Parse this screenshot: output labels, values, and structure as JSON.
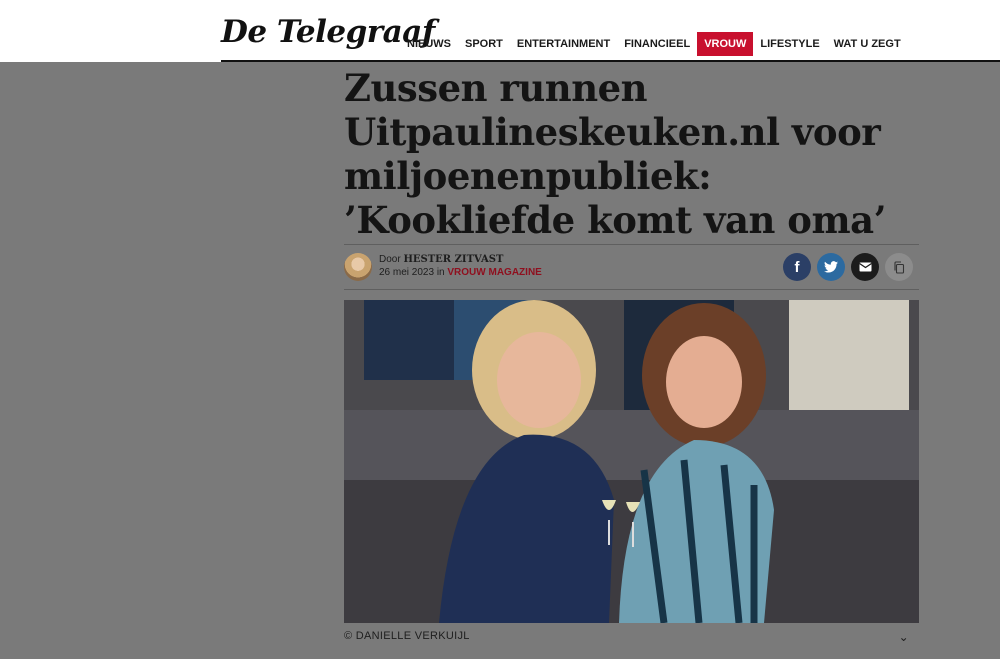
{
  "header": {
    "logo": "De Telegraaf",
    "nav": [
      {
        "label": "NIEUWS",
        "active": false
      },
      {
        "label": "SPORT",
        "active": false
      },
      {
        "label": "ENTERTAINMENT",
        "active": false
      },
      {
        "label": "FINANCIEEL",
        "active": false
      },
      {
        "label": "VROUW",
        "active": true
      },
      {
        "label": "LIFESTYLE",
        "active": false
      },
      {
        "label": "WAT U ZEGT",
        "active": false
      }
    ]
  },
  "article": {
    "headline": "Zussen runnen Uitpaulineskeuken.nl voor miljoenenpubliek: ’Kookliefde komt van oma’",
    "by_prefix": "Door ",
    "author": "HESTER ZITVAST",
    "date": "26 mei 2023",
    "in_word": " in ",
    "section": "VROUW MAGAZINE",
    "caption": "© DANIELLE VERKUIJL"
  },
  "share": {
    "facebook_icon": "f",
    "twitter_icon": "twitter-icon",
    "mail_icon": "mail-icon",
    "copy_icon": "copy-icon"
  },
  "colors": {
    "accent": "#c8102e",
    "overlay": "#7a7a7a"
  }
}
